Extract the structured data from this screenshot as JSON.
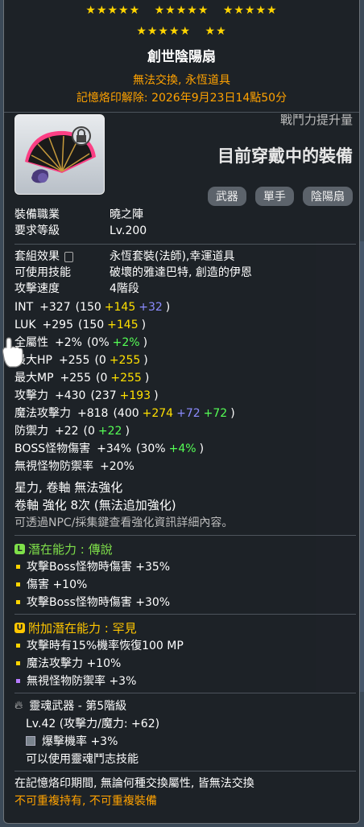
{
  "stars": {
    "row1": [
      "★★★★★",
      "★★★★★",
      "★★★★★"
    ],
    "row2": [
      "★★★★★",
      "★★"
    ]
  },
  "item": {
    "name": "創世陰陽扇",
    "trade": "無法交換, 永恆道具",
    "seal": "記憶烙印解除: 2026年9月23日14點50分"
  },
  "header": {
    "combat_power_label": "戰鬥力提升量",
    "equipped_label": "目前穿戴中的裝備",
    "tags": [
      "武器",
      "單手",
      "陰陽扇"
    ]
  },
  "info": [
    {
      "k": "裝備職業",
      "v": "曉之陣"
    },
    {
      "k": "要求等級",
      "v": "Lv.200"
    }
  ],
  "set": {
    "label": "套組效果",
    "value": "永恆套裝(法師),幸運道具"
  },
  "skills": {
    "label": "可使用技能",
    "value": "破壞的雅達巴特, 創造的伊恩"
  },
  "speed": {
    "label": "攻擊速度",
    "value": "4階段"
  },
  "stats": [
    {
      "k": "INT",
      "total": "+327",
      "base": "(150",
      "add": [
        {
          "t": "+145",
          "c": "y"
        },
        {
          "t": "+32",
          "c": "b"
        }
      ]
    },
    {
      "k": "LUK",
      "total": "+295",
      "base": "(150",
      "add": [
        {
          "t": "+145",
          "c": "y"
        }
      ]
    },
    {
      "k": "全屬性",
      "total": "+2%",
      "base": "(0%",
      "add": [
        {
          "t": "+2%",
          "c": "g"
        }
      ]
    },
    {
      "k": "最大HP",
      "total": "+255",
      "base": "(0",
      "add": [
        {
          "t": "+255",
          "c": "y"
        }
      ]
    },
    {
      "k": "最大MP",
      "total": "+255",
      "base": "(0",
      "add": [
        {
          "t": "+255",
          "c": "y"
        }
      ]
    },
    {
      "k": "攻擊力",
      "total": "+430",
      "base": "(237",
      "add": [
        {
          "t": "+193",
          "c": "y"
        }
      ]
    },
    {
      "k": "魔法攻擊力",
      "total": "+818",
      "base": "(400",
      "add": [
        {
          "t": "+274",
          "c": "y"
        },
        {
          "t": "+72",
          "c": "b"
        },
        {
          "t": "+72",
          "c": "g"
        }
      ]
    },
    {
      "k": "防禦力",
      "total": "+22",
      "base": "(0",
      "add": [
        {
          "t": "+22",
          "c": "g"
        }
      ]
    },
    {
      "k": "BOSS怪物傷害",
      "total": "+34%",
      "base": "(30%",
      "add": [
        {
          "t": "+4%",
          "c": "g"
        }
      ]
    },
    {
      "k": "無視怪物防禦率",
      "total": "+20%",
      "base": "",
      "add": []
    }
  ],
  "star_force": "星力, 卷軸 無法強化",
  "scroll": "卷軸 強化 8次 (無法追加強化)",
  "npc_hint": "可透過NPC/採集鍵查看強化資訊詳細內容。",
  "potential": {
    "title": "潛在能力 : 傳說",
    "icon": "L",
    "color": "#7fe04a",
    "lines": [
      "攻擊Boss怪物時傷害 +35%",
      "傷害 +10%",
      "攻擊Boss怪物時傷害 +30%"
    ],
    "bullet_colors": [
      "#ffd400",
      "#ffd400",
      "#ffd400"
    ]
  },
  "additional": {
    "title": "附加潛在能力 : 罕見",
    "icon": "U",
    "color": "#ffc600",
    "lines": [
      "攻擊時有15%機率恢復100 MP",
      "魔法攻擊力 +10%",
      "無視怪物防禦率 +3%"
    ],
    "bullet_colors": [
      "#ffd400",
      "#ffd400",
      "#b77cff"
    ]
  },
  "soul": {
    "title": "靈魂武器 - 第5階級",
    "level": "Lv.42 (攻擊力/魔力: +62)",
    "crit": "爆擊機率 +3%",
    "skill": "可以使用靈魂鬥志技能"
  },
  "footer": {
    "line1": "在記憶烙印期間, 無論何種交換屬性, 皆無法交換",
    "line2": "不可重複持有, 不可重複裝備"
  }
}
